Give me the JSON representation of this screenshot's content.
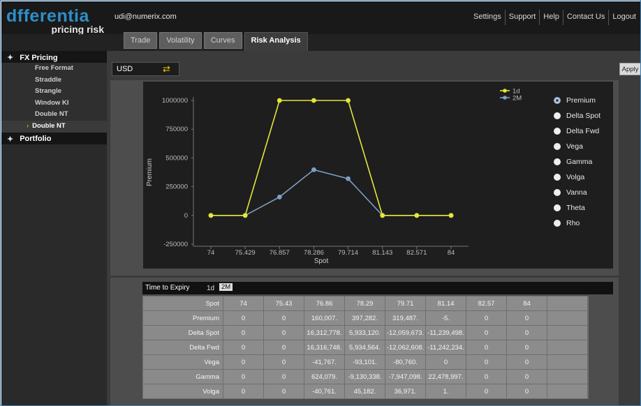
{
  "brand": {
    "name": "dfferentia",
    "tagline": "pricing risk"
  },
  "user": "udi@numerix.com",
  "top_nav": [
    "Settings",
    "Support",
    "Help",
    "Contact Us",
    "Logout"
  ],
  "tabs": [
    {
      "label": "Trade",
      "active": false
    },
    {
      "label": "Volatility",
      "active": false
    },
    {
      "label": "Curves",
      "active": false
    },
    {
      "label": "Risk Analysis",
      "active": true
    }
  ],
  "sidebar": {
    "fx_pricing": {
      "label": "FX Pricing",
      "icon": "plus-icon"
    },
    "items": [
      {
        "label": "Free Format",
        "selected": false
      },
      {
        "label": "Straddle",
        "selected": false
      },
      {
        "label": "Strangle",
        "selected": false
      },
      {
        "label": "Window KI",
        "selected": false
      },
      {
        "label": "Double NT",
        "selected": false
      },
      {
        "label": "Double NT",
        "selected": true
      }
    ],
    "portfolio": {
      "label": "Portfolio",
      "icon": "plus-icon"
    }
  },
  "currency": {
    "value": "USD",
    "icon": "swap-arrows-icon"
  },
  "apply_label": "Apply",
  "chart_data": {
    "type": "line",
    "xlabel": "Spot",
    "ylabel": "Premium",
    "x": [
      74,
      75.429,
      76.857,
      78.286,
      79.714,
      81.143,
      82.571,
      84
    ],
    "x_tick_labels": [
      "74",
      "75.429",
      "76.857",
      "78.286",
      "79.714",
      "81.143",
      "82.571",
      "84"
    ],
    "y_ticks": [
      1000000,
      750000,
      500000,
      250000,
      0,
      -250000
    ],
    "ylim": [
      -250000,
      1000000
    ],
    "grid": false,
    "legend_position": "top-right",
    "series": [
      {
        "name": "1d",
        "color": "#e4e638",
        "values": [
          0,
          0,
          1000000,
          1000000,
          1000000,
          0,
          0,
          0
        ]
      },
      {
        "name": "2M",
        "color": "#7c9ec4",
        "values": [
          0,
          0,
          160007,
          397282,
          319487,
          -5,
          0,
          0
        ]
      }
    ]
  },
  "measures": [
    {
      "label": "Premium",
      "selected": true
    },
    {
      "label": "Delta Spot",
      "selected": false
    },
    {
      "label": "Delta Fwd",
      "selected": false
    },
    {
      "label": "Vega",
      "selected": false
    },
    {
      "label": "Gamma",
      "selected": false
    },
    {
      "label": "Volga",
      "selected": false
    },
    {
      "label": "Vanna",
      "selected": false
    },
    {
      "label": "Theta",
      "selected": false
    },
    {
      "label": "Rho",
      "selected": false
    }
  ],
  "expiry": {
    "label": "Time to Expiry",
    "options": [
      "1d",
      "2M"
    ],
    "selected": "2M"
  },
  "table": {
    "header": {
      "label": "Spot",
      "cells": [
        "74",
        "75.43",
        "76.86",
        "78.29",
        "79.71",
        "81.14",
        "82.57",
        "84",
        "",
        ""
      ]
    },
    "rows": [
      {
        "label": "Premium",
        "cells": [
          "0",
          "0",
          "160,007.",
          "397,282.",
          "319,487.",
          "-5.",
          "0",
          "0",
          "",
          ""
        ]
      },
      {
        "label": "Delta Spot",
        "cells": [
          "0",
          "0",
          "16,312,778.",
          "5,933,120.",
          "-12,059,673.",
          "-11,239,498.",
          "0",
          "0",
          "",
          ""
        ]
      },
      {
        "label": "Delta Fwd",
        "cells": [
          "0",
          "0",
          "16,316,748.",
          "5,934,564.",
          "-12,062,608.",
          "-11,242,234.",
          "0",
          "0",
          "",
          ""
        ]
      },
      {
        "label": "Vega",
        "cells": [
          "0",
          "0",
          "-41,767.",
          "-93,101.",
          "-80,760.",
          "0",
          "0",
          "0",
          "",
          ""
        ]
      },
      {
        "label": "Gamma",
        "cells": [
          "0",
          "0",
          "624,079.",
          "-9,130,338.",
          "-7,947,098.",
          "22,478,997.",
          "0",
          "0",
          "",
          ""
        ]
      },
      {
        "label": "Volga",
        "cells": [
          "0",
          "0",
          "-40,761.",
          "45,182.",
          "36,971.",
          "1.",
          "0",
          "0",
          "",
          ""
        ]
      }
    ]
  }
}
